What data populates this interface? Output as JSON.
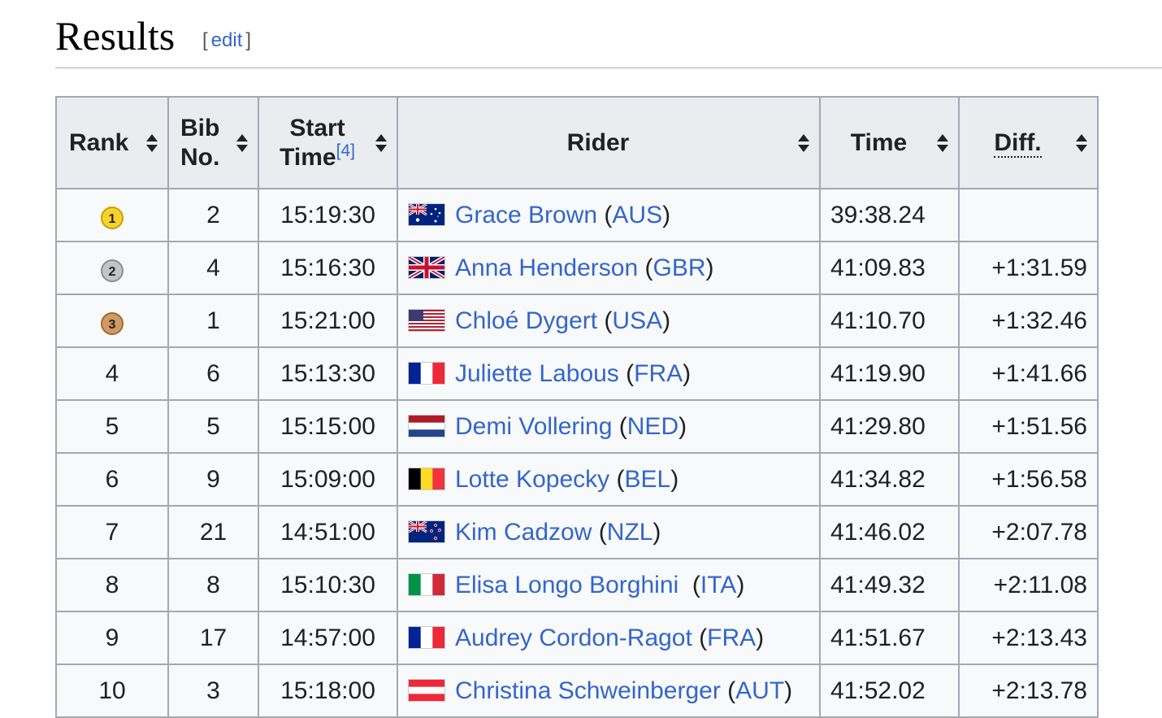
{
  "section": {
    "title": "Results",
    "edit_open": "[",
    "edit_label": "edit",
    "edit_close": "]"
  },
  "table": {
    "headers": {
      "rank": "Rank",
      "bib_line1": "Bib",
      "bib_line2": "No.",
      "start_line1": "Start",
      "start_line2": "Time",
      "start_ref": "[4]",
      "rider": "Rider",
      "time": "Time",
      "diff": "Diff."
    },
    "rows": [
      {
        "rank": "1",
        "medal": "gold",
        "bib": "2",
        "start": "15:19:30",
        "flag": "AUS-flag",
        "rider": "Grace Brown",
        "nat": "AUS",
        "time": "39:38.24",
        "diff": ""
      },
      {
        "rank": "2",
        "medal": "silver",
        "bib": "4",
        "start": "15:16:30",
        "flag": "GBR-flag",
        "rider": "Anna Henderson",
        "nat": "GBR",
        "time": "41:09.83",
        "diff": "+1:31.59"
      },
      {
        "rank": "3",
        "medal": "bronze",
        "bib": "1",
        "start": "15:21:00",
        "flag": "USA-flag",
        "rider": "Chloé Dygert",
        "nat": "USA",
        "time": "41:10.70",
        "diff": "+1:32.46"
      },
      {
        "rank": "4",
        "medal": "",
        "bib": "6",
        "start": "15:13:30",
        "flag": "FRA-flag",
        "rider": "Juliette Labous",
        "nat": "FRA",
        "time": "41:19.90",
        "diff": "+1:41.66"
      },
      {
        "rank": "5",
        "medal": "",
        "bib": "5",
        "start": "15:15:00",
        "flag": "NED-flag",
        "rider": "Demi Vollering",
        "nat": "NED",
        "time": "41:29.80",
        "diff": "+1:51.56"
      },
      {
        "rank": "6",
        "medal": "",
        "bib": "9",
        "start": "15:09:00",
        "flag": "BEL-flag",
        "rider": "Lotte Kopecky",
        "nat": "BEL",
        "time": "41:34.82",
        "diff": "+1:56.58"
      },
      {
        "rank": "7",
        "medal": "",
        "bib": "21",
        "start": "14:51:00",
        "flag": "NZL-flag",
        "rider": "Kim Cadzow",
        "nat": "NZL",
        "time": "41:46.02",
        "diff": "+2:07.78"
      },
      {
        "rank": "8",
        "medal": "",
        "bib": "8",
        "start": "15:10:30",
        "flag": "ITA-flag",
        "rider": "Elisa Longo Borghini",
        "nat": "ITA",
        "time": "41:49.32",
        "diff": "+2:11.08"
      },
      {
        "rank": "9",
        "medal": "",
        "bib": "17",
        "start": "14:57:00",
        "flag": "FRA-flag",
        "rider": "Audrey Cordon-Ragot",
        "nat": "FRA",
        "time": "41:51.67",
        "diff": "+2:13.43"
      },
      {
        "rank": "10",
        "medal": "",
        "bib": "3",
        "start": "15:18:00",
        "flag": "AUT-flag",
        "rider": "Christina Schweinberger",
        "nat": "AUT",
        "time": "41:52.02",
        "diff": "+2:13.78"
      }
    ]
  },
  "colors": {
    "link": "#3366cc",
    "header_bg": "#eaecf0",
    "cell_bg": "#f8f9fa",
    "border": "#a2a9b1",
    "gold": "#f7d22c",
    "silver": "#c4c4c4",
    "bronze": "#d29a63"
  }
}
